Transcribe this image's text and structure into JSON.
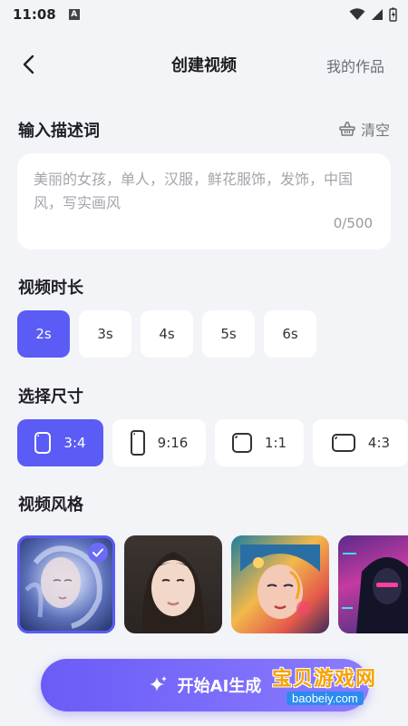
{
  "status": {
    "time": "11:08",
    "notif": "A"
  },
  "header": {
    "title": "创建视频",
    "my_works": "我的作品"
  },
  "prompt": {
    "section_title": "输入描述词",
    "clear_label": "清空",
    "text": "美丽的女孩，单人，汉服，鲜花服饰，发饰，中国风，写实画风",
    "counter": "0/500"
  },
  "duration": {
    "section_title": "视频时长",
    "options": [
      "2s",
      "3s",
      "4s",
      "5s",
      "6s"
    ],
    "selected": "2s"
  },
  "size": {
    "section_title": "选择尺寸",
    "options": [
      "3:4",
      "9:16",
      "1:1",
      "4:3"
    ],
    "selected": "3:4"
  },
  "style": {
    "section_title": "视频风格",
    "cards": [
      "ethereal-portrait",
      "realistic-portrait",
      "colorful-art-portrait",
      "cyberpunk-hooded"
    ],
    "names": [
      "",
      "",
      "",
      ""
    ]
  },
  "cta": {
    "label": "开始AI生成"
  },
  "watermark": {
    "main": "宝贝游戏网",
    "sub": "baobeiy.com"
  },
  "colors": {
    "accent": "#5b5bf6",
    "background": "#f3f4f8"
  }
}
